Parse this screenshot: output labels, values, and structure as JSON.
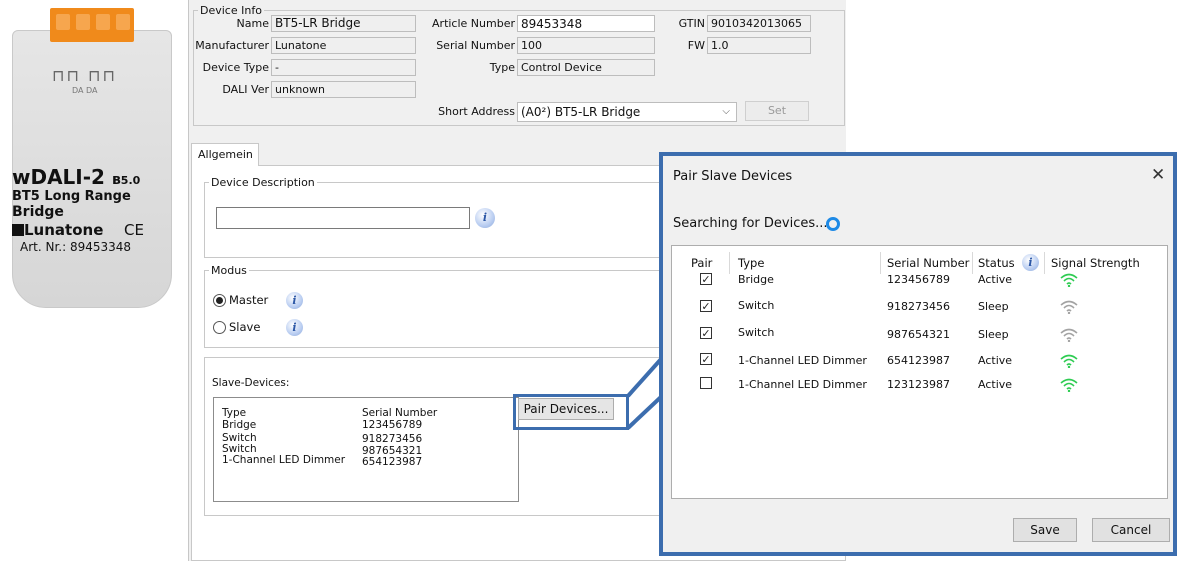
{
  "device_image": {
    "brand": "wDALI-2",
    "bt_badge": "5.0",
    "subtitle_line1": "BT5 Long Range",
    "subtitle_line2": "Bridge",
    "manufacturer_logo": "Lunatone",
    "ce_mark": "CE",
    "article": "Art. Nr.: 89453348",
    "pins": "DA DA"
  },
  "device_info": {
    "group_label": "Device Info",
    "name_label": "Name",
    "name_value": "BT5-LR Bridge",
    "manufacturer_label": "Manufacturer",
    "manufacturer_value": "Lunatone",
    "device_type_label": "Device Type",
    "device_type_value": "-",
    "dali_ver_label": "DALI Ver",
    "dali_ver_value": "unknown",
    "article_label": "Article Number",
    "article_value": "89453348",
    "serial_label": "Serial Number",
    "serial_value": "100",
    "type_label": "Type",
    "type_value": "Control Device",
    "short_address_label": "Short Address",
    "short_address_value": "(A0²) BT5-LR Bridge",
    "gtin_label": "GTIN",
    "gtin_value": "9010342013065",
    "fw_label": "FW",
    "fw_value": "1.0",
    "set_button": "Set"
  },
  "tabs": [
    "Allgemein"
  ],
  "general": {
    "description_group": "Device Description",
    "description_value": "",
    "modus_group": "Modus",
    "master_label": "Master",
    "slave_label": "Slave",
    "selected_mode": "Master",
    "slave_devices_label": "Slave-Devices:",
    "slave_list_headers": [
      "Type",
      "Serial Number"
    ],
    "slave_list": [
      {
        "type": "Bridge",
        "serial": "123456789"
      },
      {
        "type": "Switch",
        "serial": "918273456"
      },
      {
        "type": "Switch",
        "serial": "987654321"
      },
      {
        "type": "1-Channel LED Dimmer",
        "serial": "654123987"
      }
    ],
    "pair_devices_button": "Pair Devices..."
  },
  "dialog": {
    "title": "Pair Slave Devices",
    "close": "✕",
    "searching": "Searching for Devices...",
    "headers": {
      "pair": "Pair",
      "type": "Type",
      "serial": "Serial Number",
      "status": "Status",
      "signal": "Signal Strength"
    },
    "rows": [
      {
        "pair": true,
        "type": "Bridge",
        "serial": "123456789",
        "status": "Active",
        "signal_color": "#2ecc52"
      },
      {
        "pair": true,
        "type": "Switch",
        "serial": "918273456",
        "status": "Sleep",
        "signal_color": "#a3a3a3"
      },
      {
        "pair": true,
        "type": "Switch",
        "serial": "987654321",
        "status": "Sleep",
        "signal_color": "#a3a3a3"
      },
      {
        "pair": true,
        "type": "1-Channel LED Dimmer",
        "serial": "654123987",
        "status": "Active",
        "signal_color": "#2ecc52"
      },
      {
        "pair": false,
        "type": "1-Channel LED Dimmer",
        "serial": "123123987",
        "status": "Active",
        "signal_color": "#2ecc52"
      }
    ],
    "save_button": "Save",
    "cancel_button": "Cancel"
  },
  "colors": {
    "highlight": "#3c6dae",
    "terminal": "#f08a1b",
    "spinner": "#1e8ae6"
  }
}
